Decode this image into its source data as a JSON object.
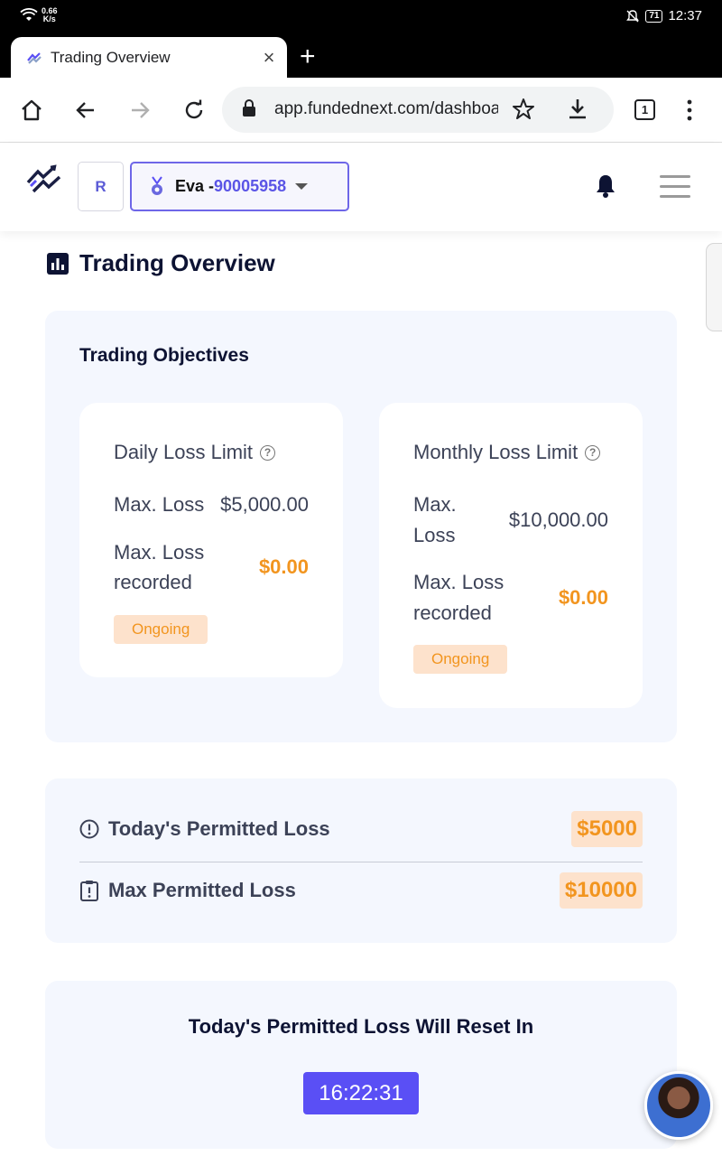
{
  "status_bar": {
    "speed_value": "0.66",
    "speed_unit": "K/s",
    "battery": "71",
    "time": "12:37"
  },
  "browser": {
    "tab_title": "Trading Overview",
    "tab_close": "×",
    "new_tab": "+",
    "url": "app.fundednext.com/dashboard",
    "tab_count": "1"
  },
  "header": {
    "avatar_initial": "R",
    "account_name": "Eva -",
    "account_number": "90005958"
  },
  "page": {
    "title": "Trading Overview"
  },
  "objectives": {
    "title": "Trading Objectives",
    "daily": {
      "title": "Daily Loss Limit",
      "max_loss_label": "Max. Loss",
      "max_loss_value": "$5,000.00",
      "recorded_label_1": "Max. Loss",
      "recorded_label_2": "recorded",
      "recorded_value": "$0.00",
      "status": "Ongoing"
    },
    "monthly": {
      "title": "Monthly Loss Limit",
      "max_loss_label_1": "Max.",
      "max_loss_label_2": "Loss",
      "max_loss_value": "$10,000.00",
      "recorded_label_1": "Max. Loss",
      "recorded_label_2": "recorded",
      "recorded_value": "$0.00",
      "status": "Ongoing"
    }
  },
  "permitted": {
    "today_label": "Today's Permitted Loss",
    "today_value": "$5000",
    "max_label": "Max Permitted Loss",
    "max_value": "$10000"
  },
  "reset": {
    "title": "Today's Permitted Loss Will Reset In",
    "timer": "16:22:31"
  },
  "colors": {
    "accent": "#5a4ff5",
    "orange": "#f2951f",
    "badge_bg": "#fde2cc",
    "panel_bg": "#f4f7fe"
  }
}
